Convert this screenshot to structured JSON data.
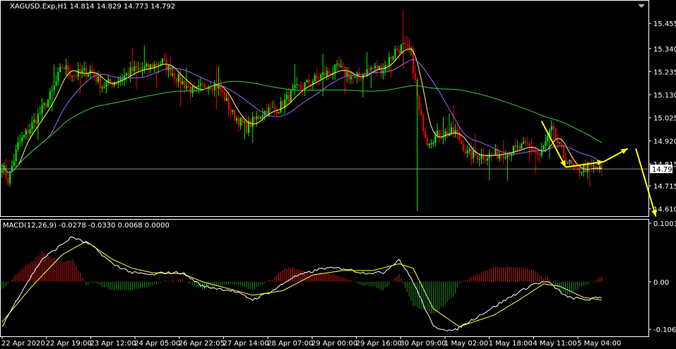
{
  "colors": {
    "background": "#000000",
    "frame": "#ffffff",
    "bull_candle": "#00e600",
    "bear_candle": "#e60000",
    "ma_fast": "#ffff66",
    "ma_mid": "#9966ff",
    "ma_slow": "#33cc33",
    "macd_signal": "#ffff33",
    "macd_main": "#ffffff",
    "hist_pos": "#cc1a1a",
    "hist_neg": "#1f8a1f",
    "arrow": "#ffff00",
    "bid_line": "#c0c0c0"
  },
  "chart_data": [
    {
      "type": "candlestick",
      "title": "XAGUSD.Exp,H1  14.814 14.829 14.773 14.792",
      "symbol": "XAGUSD.Exp,H1",
      "ohlc_header": [
        "14.814",
        "14.829",
        "14.773",
        "14.792"
      ],
      "current_price": "14.792",
      "ylim": [
        14.58,
        15.555
      ],
      "y_ticks": [
        "15.455",
        "15.340",
        "15.235",
        "15.130",
        "15.025",
        "14.920",
        "14.815",
        "14.715",
        "14.610"
      ],
      "x_ticks": [
        "22 Apr 2020",
        "22 Apr 19:00",
        "23 Apr 12:00",
        "24 Apr 05:00",
        "26 Apr 22:05",
        "27 Apr 14:00",
        "28 Apr 07:00",
        "29 Apr 00:00",
        "29 Apr 16:00",
        "30 Apr 09:00",
        "1 May 02:00",
        "1 May 18:00",
        "4 May 11:00",
        "5 May 04:00"
      ],
      "close_anchors": [
        [
          0,
          14.81
        ],
        [
          3,
          14.74
        ],
        [
          8,
          14.9
        ],
        [
          14,
          14.98
        ],
        [
          20,
          15.06
        ],
        [
          25,
          15.14
        ],
        [
          30,
          15.26
        ],
        [
          36,
          15.22
        ],
        [
          44,
          15.24
        ],
        [
          50,
          15.17
        ],
        [
          58,
          15.2
        ],
        [
          65,
          15.24
        ],
        [
          72,
          15.25
        ],
        [
          80,
          15.28
        ],
        [
          88,
          15.2
        ],
        [
          96,
          15.14
        ],
        [
          102,
          15.18
        ],
        [
          108,
          15.17
        ],
        [
          115,
          15.04
        ],
        [
          122,
          14.98
        ],
        [
          130,
          15.05
        ],
        [
          138,
          15.07
        ],
        [
          146,
          15.15
        ],
        [
          152,
          15.18
        ],
        [
          160,
          15.22
        ],
        [
          168,
          15.25
        ],
        [
          176,
          15.2
        ],
        [
          184,
          15.25
        ],
        [
          190,
          15.25
        ],
        [
          196,
          15.33
        ],
        [
          200,
          15.35
        ],
        [
          204,
          15.32
        ],
        [
          208,
          15.05
        ],
        [
          212,
          14.92
        ],
        [
          218,
          14.95
        ],
        [
          226,
          14.96
        ],
        [
          232,
          14.86
        ],
        [
          240,
          14.85
        ],
        [
          248,
          14.86
        ],
        [
          256,
          14.88
        ],
        [
          262,
          14.9
        ],
        [
          268,
          14.85
        ],
        [
          274,
          14.97
        ],
        [
          280,
          14.85
        ],
        [
          286,
          14.78
        ],
        [
          292,
          14.8
        ],
        [
          298,
          14.79
        ]
      ],
      "moving_averages": [
        {
          "name": "MA fast",
          "color": "#ffff66",
          "period": 8
        },
        {
          "name": "MA mid",
          "color": "#9966ff",
          "period": 24
        },
        {
          "name": "MA slow",
          "color": "#33cc33",
          "period": 100
        }
      ],
      "bid_line": 14.792,
      "annotations": [
        {
          "type": "arrow",
          "color": "#ffff00",
          "from": [
            269,
            15.01
          ],
          "to": [
            281,
            14.8
          ]
        },
        {
          "type": "arrow",
          "color": "#ffff00",
          "from": [
            281,
            14.8
          ],
          "to": [
            300,
            14.825
          ]
        },
        {
          "type": "arrow",
          "color": "#ffff00",
          "from": [
            300,
            14.825
          ],
          "to": [
            312,
            14.885
          ]
        },
        {
          "type": "arrow",
          "color": "#ffff00",
          "from": [
            316,
            14.885
          ],
          "to": [
            326,
            14.575
          ]
        }
      ]
    },
    {
      "type": "line",
      "title": "MACD(12,26,9) -0.0278 -0.0330 0.0068 0.0000",
      "ylim": [
        -0.12,
        0.135
      ],
      "y_ticks": [
        "0.1003",
        "0.00",
        "-0.106"
      ],
      "series": [
        {
          "name": "MACD",
          "color": "#ffffff",
          "anchors": [
            [
              0,
              -0.1
            ],
            [
              10,
              -0.02
            ],
            [
              20,
              0.05
            ],
            [
              35,
              0.1
            ],
            [
              45,
              0.08
            ],
            [
              55,
              0.04
            ],
            [
              65,
              0.02
            ],
            [
              75,
              0.015
            ],
            [
              80,
              0.02
            ],
            [
              90,
              0.02
            ],
            [
              100,
              -0.01
            ],
            [
              115,
              -0.02
            ],
            [
              125,
              -0.04
            ],
            [
              135,
              -0.02
            ],
            [
              145,
              0.01
            ],
            [
              160,
              0.03
            ],
            [
              170,
              0.03
            ],
            [
              180,
              0.02
            ],
            [
              190,
              0.02
            ],
            [
              198,
              0.05
            ],
            [
              205,
              0.0
            ],
            [
              215,
              -0.1
            ],
            [
              225,
              -0.11
            ],
            [
              240,
              -0.07
            ],
            [
              255,
              -0.03
            ],
            [
              265,
              -0.005
            ],
            [
              272,
              0.0
            ],
            [
              282,
              -0.035
            ],
            [
              292,
              -0.04
            ],
            [
              298,
              -0.035
            ]
          ]
        },
        {
          "name": "Signal",
          "color": "#ffff33",
          "anchors": [
            [
              0,
              -0.09
            ],
            [
              15,
              -0.01
            ],
            [
              30,
              0.06
            ],
            [
              42,
              0.09
            ],
            [
              55,
              0.05
            ],
            [
              65,
              0.03
            ],
            [
              75,
              0.02
            ],
            [
              90,
              0.018
            ],
            [
              100,
              0.0
            ],
            [
              115,
              -0.018
            ],
            [
              125,
              -0.03
            ],
            [
              140,
              -0.02
            ],
            [
              155,
              0.015
            ],
            [
              170,
              0.025
            ],
            [
              185,
              0.025
            ],
            [
              198,
              0.04
            ],
            [
              205,
              0.03
            ],
            [
              215,
              -0.06
            ],
            [
              228,
              -0.1
            ],
            [
              245,
              -0.075
            ],
            [
              258,
              -0.04
            ],
            [
              270,
              -0.005
            ],
            [
              278,
              -0.01
            ],
            [
              290,
              -0.035
            ],
            [
              298,
              -0.04
            ]
          ]
        }
      ]
    }
  ]
}
